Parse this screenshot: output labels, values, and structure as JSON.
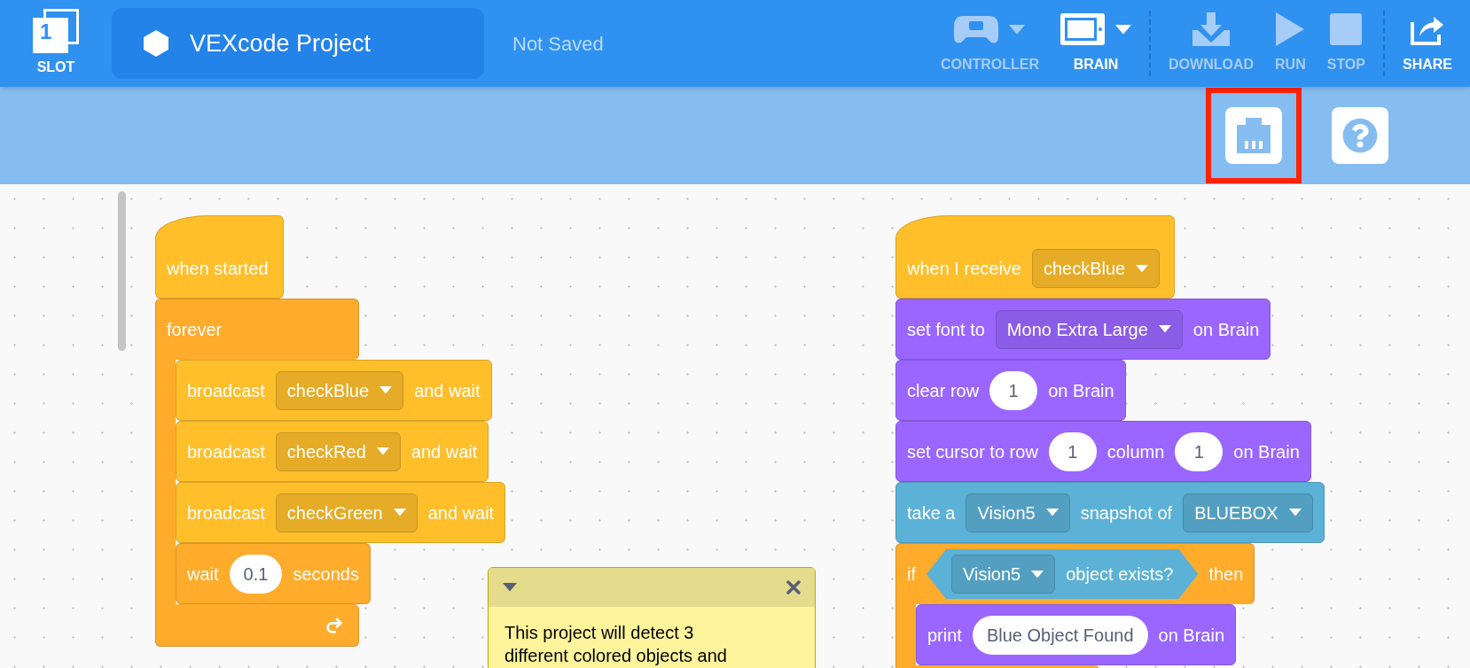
{
  "header": {
    "slot": {
      "number": "1",
      "label": "SLOT"
    },
    "project_name": "VEXcode Project",
    "save_status": "Not Saved",
    "toolbar_groups": [
      [
        {
          "kind": "controller",
          "label": "CONTROLLER",
          "disabled": true,
          "has_menu": true
        },
        {
          "kind": "brain",
          "label": "BRAIN",
          "disabled": false,
          "has_menu": true
        }
      ],
      [
        {
          "kind": "download",
          "label": "DOWNLOAD",
          "disabled": true,
          "has_menu": false
        },
        {
          "kind": "run",
          "label": "RUN",
          "disabled": true,
          "has_menu": false
        },
        {
          "kind": "stop",
          "label": "STOP",
          "disabled": true,
          "has_menu": false
        }
      ],
      [
        {
          "kind": "share",
          "label": "SHARE",
          "disabled": false,
          "has_menu": false
        }
      ]
    ]
  },
  "subbar": {
    "buttons": [
      {
        "kind": "devices",
        "highlighted": true
      },
      {
        "kind": "help",
        "highlighted": false
      }
    ]
  },
  "canvas": {
    "stacks": [
      [
        {
          "kind": "hat",
          "color": "#ffbf2b",
          "parts": [
            {
              "kind": "text",
              "text": "when started"
            }
          ]
        },
        {
          "kind": "loop",
          "color": "#ffab2b",
          "parts": [
            {
              "kind": "text",
              "text": "forever"
            }
          ],
          "children": [
            {
              "kind": "command",
              "color": "#ffbf2b",
              "parts": [
                {
                  "kind": "text",
                  "text": "broadcast"
                },
                {
                  "kind": "dropdown",
                  "text": "checkBlue"
                },
                {
                  "kind": "text",
                  "text": "and wait"
                }
              ]
            },
            {
              "kind": "command",
              "color": "#ffbf2b",
              "parts": [
                {
                  "kind": "text",
                  "text": "broadcast"
                },
                {
                  "kind": "dropdown",
                  "text": "checkRed"
                },
                {
                  "kind": "text",
                  "text": "and wait"
                }
              ]
            },
            {
              "kind": "command",
              "color": "#ffbf2b",
              "parts": [
                {
                  "kind": "text",
                  "text": "broadcast"
                },
                {
                  "kind": "dropdown",
                  "text": "checkGreen"
                },
                {
                  "kind": "text",
                  "text": "and wait"
                }
              ]
            },
            {
              "kind": "command",
              "color": "#ffab2b",
              "parts": [
                {
                  "kind": "text",
                  "text": "wait"
                },
                {
                  "kind": "input",
                  "text": "0.1"
                },
                {
                  "kind": "text",
                  "text": "seconds"
                }
              ]
            }
          ]
        }
      ],
      [
        {
          "kind": "hat",
          "color": "#ffbf2b",
          "parts": [
            {
              "kind": "text",
              "text": "when I receive"
            },
            {
              "kind": "dropdown",
              "text": "checkBlue"
            }
          ]
        },
        {
          "kind": "command",
          "color": "#9a66ff",
          "parts": [
            {
              "kind": "text",
              "text": "set font to"
            },
            {
              "kind": "dropdown",
              "text": "Mono Extra Large"
            },
            {
              "kind": "text",
              "text": "on Brain"
            }
          ]
        },
        {
          "kind": "command",
          "color": "#9a66ff",
          "parts": [
            {
              "kind": "text",
              "text": "clear row"
            },
            {
              "kind": "input",
              "text": "1"
            },
            {
              "kind": "text",
              "text": "on Brain"
            }
          ]
        },
        {
          "kind": "command",
          "color": "#9a66ff",
          "parts": [
            {
              "kind": "text",
              "text": "set cursor to row"
            },
            {
              "kind": "input",
              "text": "1"
            },
            {
              "kind": "text",
              "text": "column"
            },
            {
              "kind": "input",
              "text": "1"
            },
            {
              "kind": "text",
              "text": "on Brain"
            }
          ]
        },
        {
          "kind": "command",
          "color": "#5cb1d6",
          "parts": [
            {
              "kind": "text",
              "text": "take a"
            },
            {
              "kind": "dropdown",
              "text": "Vision5"
            },
            {
              "kind": "text",
              "text": "snapshot of"
            },
            {
              "kind": "dropdown",
              "text": "BLUEBOX"
            }
          ]
        },
        {
          "kind": "branch",
          "color": "#ffab2b",
          "parts": [
            {
              "kind": "text",
              "text": "if"
            },
            {
              "kind": "boolean",
              "color": "#5cb1d6",
              "parts": [
                {
                  "kind": "dropdown",
                  "text": "Vision5"
                },
                {
                  "kind": "text",
                  "text": "object exists?"
                }
              ]
            },
            {
              "kind": "text",
              "text": "then"
            }
          ],
          "children": [
            {
              "kind": "command",
              "color": "#9a66ff",
              "parts": [
                {
                  "kind": "text",
                  "text": "print"
                },
                {
                  "kind": "input",
                  "text": "Blue Object Found"
                },
                {
                  "kind": "text",
                  "text": "on Brain"
                }
              ]
            }
          ]
        }
      ]
    ],
    "comment": {
      "collapsed": false,
      "text": "This project will detect 3 different colored objects and"
    }
  }
}
